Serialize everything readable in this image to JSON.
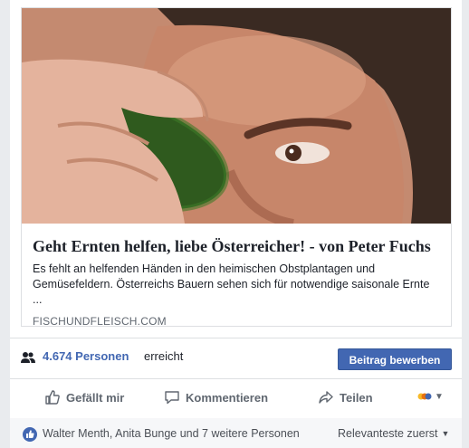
{
  "link_preview": {
    "title": "Geht Ernten helfen, liebe Österreicher! - von Peter Fuchs",
    "description": "Es fehlt an helfenden Händen in den heimischen Obstplantagen und Gemüsefeldern. Österreichs Bauern sehen sich für notwendige saisonale Ernte ...",
    "domain": "FISCHUNDFLEISCH.COM",
    "image_icon": "man-holding-cucumber-photo"
  },
  "reach": {
    "icon": "people-icon",
    "count": "4.674 Personen",
    "suffix": "erreicht",
    "boost_label": "Beitrag bewerben"
  },
  "actions": {
    "like_label": "Gefällt mir",
    "comment_label": "Kommentieren",
    "share_label": "Teilen"
  },
  "reactions": {
    "text": "Walter Menth, Anita Bunge und 7 weitere Personen",
    "sort_label": "Relevanteste zuerst"
  },
  "colors": {
    "brand": "#4267b2",
    "muted_text": "#606770",
    "background": "#e9ebee"
  }
}
